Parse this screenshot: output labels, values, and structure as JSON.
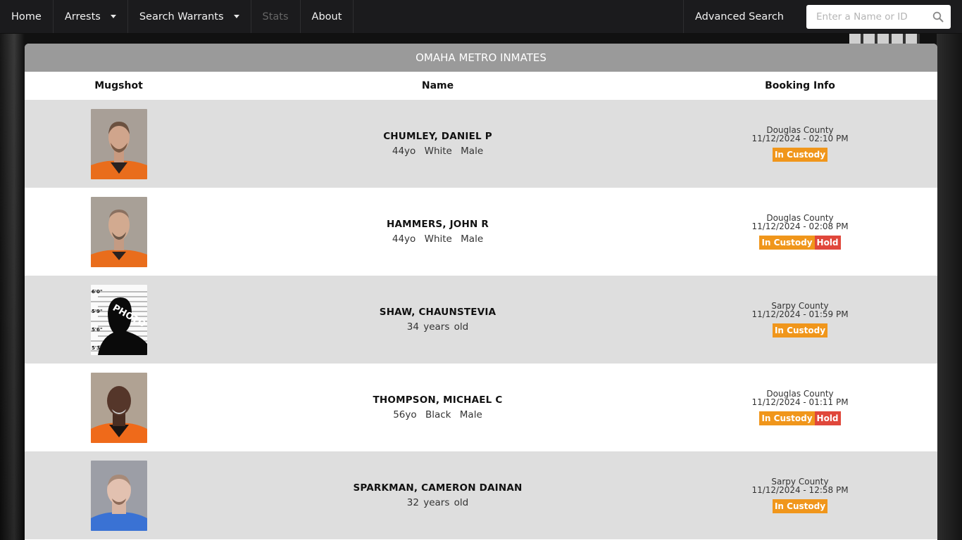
{
  "nav": {
    "items": [
      {
        "label": "Home",
        "dropdown": false,
        "disabled": false
      },
      {
        "label": "Arrests",
        "dropdown": true,
        "disabled": false
      },
      {
        "label": "Search Warrants",
        "dropdown": true,
        "disabled": false
      },
      {
        "label": "Stats",
        "dropdown": false,
        "disabled": true
      },
      {
        "label": "About",
        "dropdown": false,
        "disabled": false
      }
    ],
    "advanced_search": "Advanced Search",
    "search_placeholder": "Enter a Name or ID",
    "search_value": ""
  },
  "panel": {
    "title": "OMAHA METRO INMATES",
    "columns": {
      "mugshot": "Mugshot",
      "name": "Name",
      "booking": "Booking Info"
    }
  },
  "colors": {
    "custody": "#f0961b",
    "hold": "#e0473b",
    "panel_header": "#9a9a9a",
    "row_alt": "#dedede"
  },
  "inmates": [
    {
      "name": "CHUMLEY, DANIEL P",
      "age": "44yo",
      "race": "White",
      "sex": "Male",
      "county": "Douglas County",
      "booked": "11/12/2024 - 02:10 PM",
      "status": "In Custody",
      "hold": null,
      "photo": "mugshot-orange-jumpsuit"
    },
    {
      "name": "HAMMERS, JOHN R",
      "age": "44yo",
      "race": "White",
      "sex": "Male",
      "county": "Douglas County",
      "booked": "11/12/2024 - 02:08 PM",
      "status": "In Custody",
      "hold": "Hold",
      "photo": "mugshot-orange-jumpsuit"
    },
    {
      "name": "SHAW, CHAUNSTEVIA",
      "age_text": "34 years old",
      "county": "Sarpy County",
      "booked": "11/12/2024 - 01:59 PM",
      "status": "In Custody",
      "hold": null,
      "photo": "no-photo-placeholder",
      "placeholder": {
        "heights": [
          "6'0\"",
          "5'9\"",
          "5'6\"",
          "5'3\""
        ],
        "label": "PHOTO"
      }
    },
    {
      "name": "THOMPSON, MICHAEL C",
      "age": "56yo",
      "race": "Black",
      "sex": "Male",
      "county": "Douglas County",
      "booked": "11/12/2024 - 01:11 PM",
      "status": "In Custody",
      "hold": "Hold",
      "photo": "mugshot-orange-jumpsuit"
    },
    {
      "name": "SPARKMAN, CAMERON DAINAN",
      "age_text": "32 years old",
      "county": "Sarpy County",
      "booked": "11/12/2024 - 12:58 PM",
      "status": "In Custody",
      "hold": null,
      "photo": "mugshot-blue-shirt"
    }
  ]
}
